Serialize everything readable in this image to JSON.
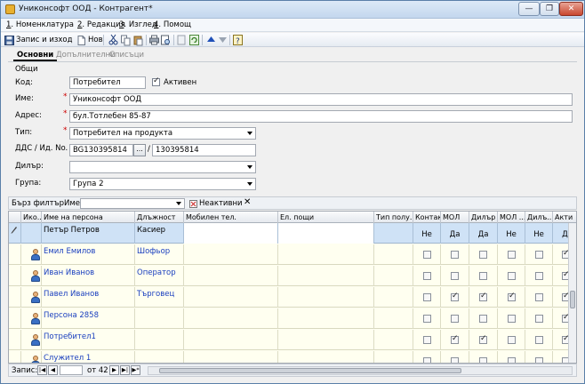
{
  "window": {
    "title": "Униконсофт ООД - Контрагент*",
    "min": "—",
    "max": "❐",
    "close": "✕"
  },
  "menu": [
    {
      "num": "1",
      "label": ". Номенклатура"
    },
    {
      "num": "2",
      "label": ". Редакция"
    },
    {
      "num": "3",
      "label": ". Изглед"
    },
    {
      "num": "4",
      "label": ". Помощ"
    }
  ],
  "toolbar": {
    "save_label": "Запис и изход",
    "new_label": "Нов"
  },
  "tabs": [
    "Основни",
    "Допълнителни",
    "Списъци"
  ],
  "form": {
    "group": "Общи",
    "code_label": "Код:",
    "code_value": "Потребител",
    "active_label": "Активен",
    "active_checked": true,
    "name_label": "Име:",
    "name_value": "Униконсофт ООД",
    "address_label": "Адрес:",
    "address_value": "бул.Тотлебен 85-87",
    "type_label": "Тип:",
    "type_value": "Потребител на продукта",
    "vat_label": "ДДС / Ид. No.",
    "vat_value": "BG130395814",
    "vat_button": "...",
    "slash": "/",
    "id_value": "130395814",
    "dealer_label": "Дилър:",
    "dealer_value": "",
    "group_label": "Група:",
    "group_value": "Група 2",
    "required_mark": "*"
  },
  "filter": {
    "quick": "Бърз филтър",
    "name_label": "Име:",
    "name_value": "",
    "inactive": "Неактивни",
    "clear": "✕"
  },
  "grid": {
    "columns": [
      "Ико...",
      "Име на персона",
      "Длъжност",
      "Мобилен тел.",
      "Ел. пощи",
      "Тип полу...",
      "Контакт",
      "МОЛ",
      "Дилър",
      "МОЛ ...",
      "Дилъ...",
      "Акти"
    ],
    "edit_row": {
      "name": "Петър Петров",
      "position": "Касиер",
      "contact": "Не",
      "mol": "Да",
      "dealer": "Да",
      "mol2": "Не",
      "dealer2": "Не",
      "active": "Д"
    },
    "rows": [
      {
        "name": "Емил Емилов",
        "position": "Шофьор",
        "contact": false,
        "mol": false,
        "dealer": false,
        "mol2": false,
        "dealer2": false,
        "active": true
      },
      {
        "name": "Иван Иванов",
        "position": "Оператор",
        "contact": false,
        "mol": false,
        "dealer": false,
        "mol2": false,
        "dealer2": false,
        "active": true
      },
      {
        "name": "Павел Иванов",
        "position": "Търговец",
        "contact": false,
        "mol": true,
        "dealer": true,
        "mol2": true,
        "dealer2": false,
        "active": true
      },
      {
        "name": "Персона 2858",
        "position": "",
        "contact": false,
        "mol": false,
        "dealer": false,
        "mol2": false,
        "dealer2": false,
        "active": true
      },
      {
        "name": "Потребител1",
        "position": "",
        "contact": false,
        "mol": true,
        "dealer": true,
        "mol2": false,
        "dealer2": false,
        "active": true
      },
      {
        "name": "Служител 1",
        "position": "",
        "contact": false,
        "mol": false,
        "dealer": false,
        "mol2": false,
        "dealer2": false,
        "active": false
      }
    ]
  },
  "status": {
    "record_label": "Запис:",
    "of_label": "от 42"
  },
  "colors": {
    "accent": "#1a3fbf",
    "grid_bg": "#fffff0",
    "edit_row": "#cfe2f6"
  }
}
